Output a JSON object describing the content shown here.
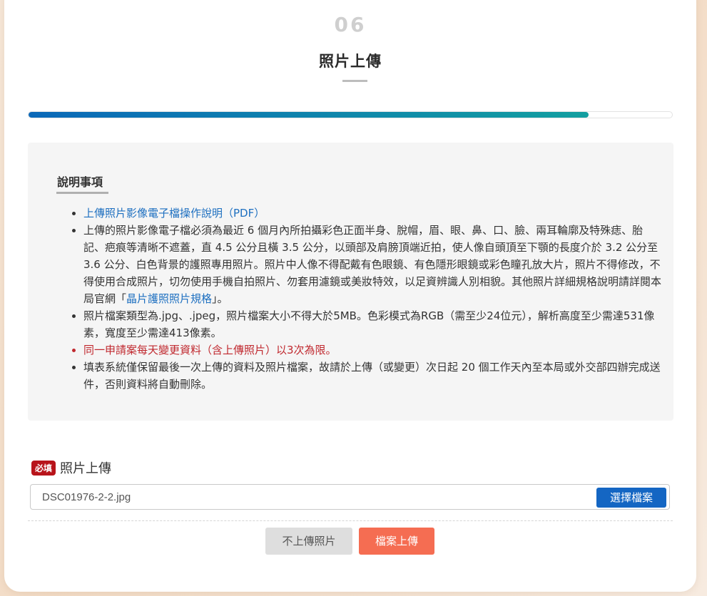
{
  "step": {
    "number": "06",
    "title": "照片上傳",
    "progress_percent": 87
  },
  "notes": {
    "heading": "說明事項",
    "items": [
      {
        "link_text": "上傳照片影像電子檔操作說明（PDF）"
      },
      {
        "text": "上傳的照片影像電子檔必須為最近 6 個月內所拍攝彩色正面半身、脫帽，眉、眼、鼻、口、臉、兩耳輪廓及特殊痣、胎記、疤痕等清晰不遮蓋，直 4.5 公分且橫 3.5 公分，以頭部及肩膀頂端近拍，使人像自頭頂至下顎的長度介於 3.2 公分至 3.6 公分、白色背景的護照專用照片。照片中人像不得配戴有色眼鏡、有色隱形眼鏡或彩色瞳孔放大片，照片不得修改，不得使用合成照片，切勿使用手機自拍照片、勿套用濾鏡或美妝特效，以足資辨識人別相貌。其他照片詳細規格說明請詳閱本局官網「",
        "link_text": "晶片護照照片規格",
        "text_after": "」。"
      },
      {
        "text": "照片檔案類型為.jpg、.jpeg，照片檔案大小不得大於5MB。色彩模式為RGB（需至少24位元），解析高度至少需達531像素，寬度至少需達413像素。"
      },
      {
        "text": "同一申請案每天變更資料（含上傳照片）以3次為限。"
      },
      {
        "text": "填表系統僅保留最後一次上傳的資料及照片檔案，故請於上傳（或變更）次日起 20 個工作天內至本局或外交部四辦完成送件，否則資料將自動刪除。"
      }
    ]
  },
  "upload": {
    "required_badge": "必填",
    "label": "照片上傳",
    "file_name": "DSC01976-2-2.jpg",
    "choose_button": "選擇檔案"
  },
  "actions": {
    "skip_label": "不上傳照片",
    "upload_label": "檔案上傳"
  },
  "colors": {
    "progress_start": "#0b68b8",
    "progress_end": "#139fa0",
    "required": "#b8141b",
    "primary_button": "#1466c3",
    "submit_button": "#f56d52",
    "warning_text": "#c0282e"
  }
}
